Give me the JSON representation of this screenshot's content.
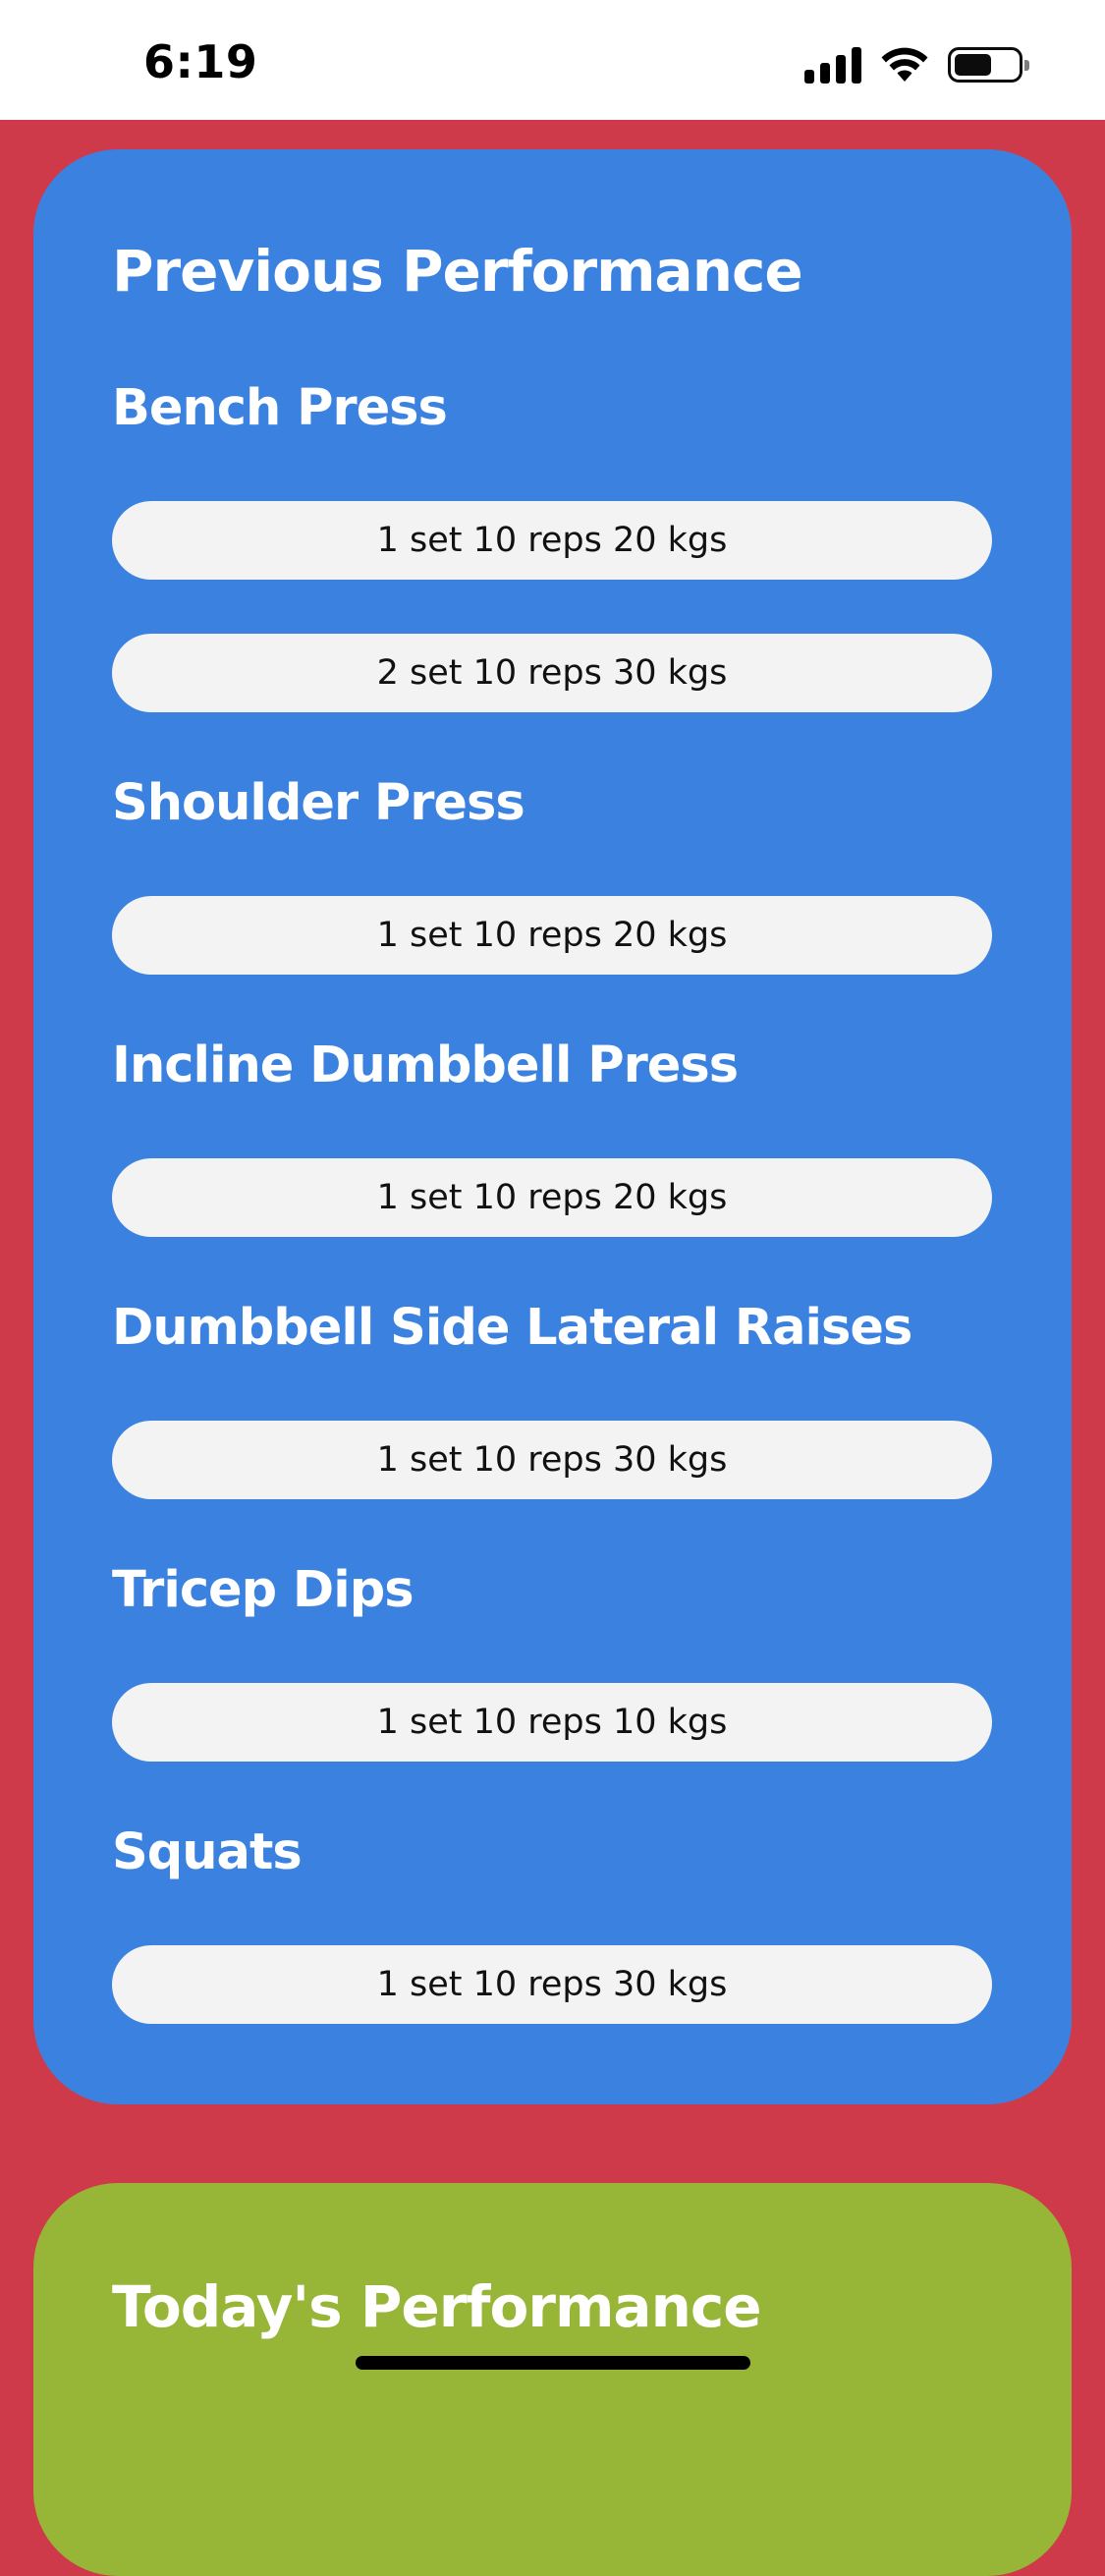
{
  "status_bar": {
    "time": "6:19",
    "icons": [
      "cellular-signal-icon",
      "wifi-icon",
      "battery-icon"
    ],
    "battery_level": 0.6
  },
  "previous_performance": {
    "title": "Previous Performance",
    "exercises": [
      {
        "name": "Bench Press",
        "sets": [
          "1 set 10 reps 20 kgs",
          "2 set 10 reps 30 kgs"
        ]
      },
      {
        "name": "Shoulder Press",
        "sets": [
          "1 set 10 reps 20 kgs"
        ]
      },
      {
        "name": "Incline Dumbbell Press",
        "sets": [
          "1 set 10 reps 20 kgs"
        ]
      },
      {
        "name": "Dumbbell Side Lateral Raises",
        "sets": [
          "1 set 10 reps 30 kgs"
        ]
      },
      {
        "name": "Tricep Dips",
        "sets": [
          "1 set 10 reps 10 kgs"
        ]
      },
      {
        "name": "Squats",
        "sets": [
          "1 set 10 reps 30 kgs"
        ]
      }
    ]
  },
  "todays_performance": {
    "title": "Today's Performance"
  },
  "colors": {
    "background": "#CF3A4A",
    "previous_card": "#3B82E0",
    "today_card": "#97B536",
    "pill": "#F3F3F3"
  }
}
